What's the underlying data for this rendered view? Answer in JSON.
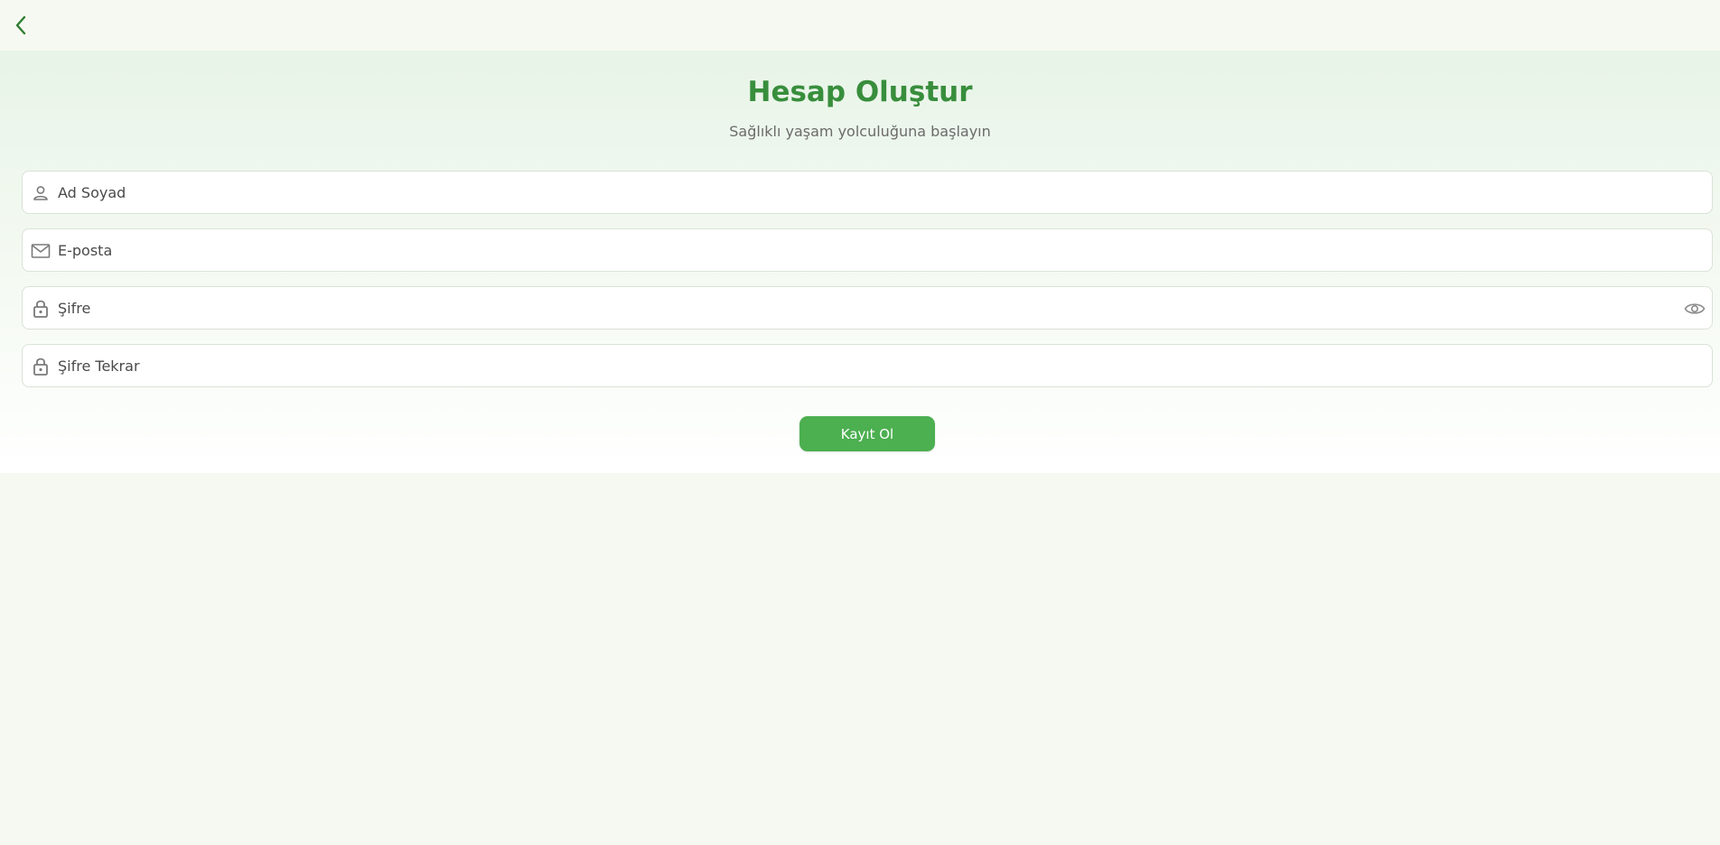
{
  "header": {
    "back_icon": "chevron-left-icon"
  },
  "form": {
    "title": "Hesap Oluştur",
    "subtitle": "Sağlıklı yaşam yolculuğuna başlayın",
    "fields": [
      {
        "icon": "person-icon",
        "placeholder": "Ad Soyad",
        "value": ""
      },
      {
        "icon": "mail-icon",
        "placeholder": "E-posta",
        "value": ""
      },
      {
        "icon": "lock-icon",
        "placeholder": "Şifre",
        "value": "",
        "trailing_icon": "eye-icon"
      },
      {
        "icon": "lock-icon",
        "placeholder": "Şifre Tekrar",
        "value": ""
      }
    ],
    "submit_label": "Kayıt Ol"
  },
  "colors": {
    "accent": "#388e3c",
    "button": "#4caf50",
    "background": "#f6f9f1"
  }
}
